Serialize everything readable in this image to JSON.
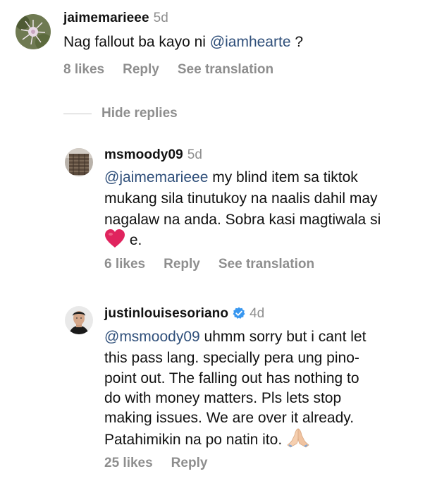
{
  "comments": [
    {
      "username": "jaimemarieee",
      "time": "5d",
      "text_prefix": "Nag fallout ba kayo ni ",
      "mention": "@iamhearte",
      "text_suffix": " ?",
      "likes": "8 likes",
      "reply": "Reply",
      "translation": "See translation"
    },
    {
      "username": "msmoody09",
      "time": "5d",
      "mention": "@jaimemarieee",
      "line1_rest": " my blind item sa tiktok",
      "line2": "mukang sila tinutukoy na naalis dahil may",
      "line3": "nagalaw na anda. Sobra kasi magtiwala si",
      "line4_suffix": " e.",
      "likes": "6 likes",
      "reply": "Reply",
      "translation": "See translation"
    },
    {
      "username": "justinlouisesoriano",
      "time": "4d",
      "verified": true,
      "mention": "@msmoody09",
      "line1_rest": " uhmm sorry but i cant let",
      "line2": "this pass lang. specially pera ung pino-",
      "line3": "point out. The falling out has nothing to",
      "line4": "do with money matters. Pls lets stop",
      "line5": "making issues. We are over it already.",
      "line6": "Patahimikin na po natin ito.",
      "likes": "25 likes",
      "reply": "Reply"
    }
  ],
  "hide_replies": "Hide replies",
  "icons": {
    "heart": "red-heart-icon",
    "pray": "folded-hands-icon",
    "verified": "verified-badge-icon"
  },
  "colors": {
    "mention": "#2f4f7a",
    "muted": "#8e8e8e",
    "verified": "#3897f0",
    "heart": "#e0245e"
  }
}
